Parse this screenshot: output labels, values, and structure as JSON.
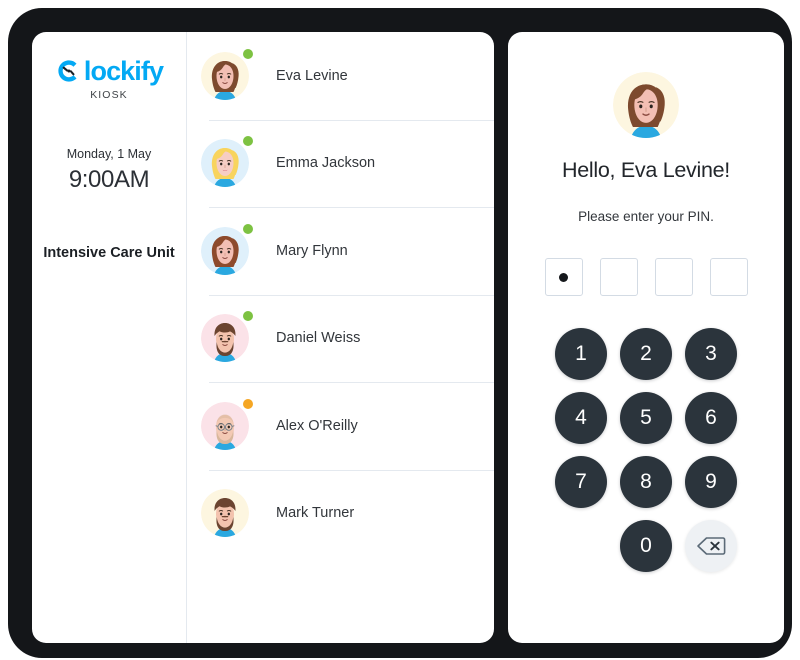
{
  "device": {
    "bezel_color": "#141619",
    "screen_bg": "#ffffff"
  },
  "colors": {
    "brand": "#03a9f4",
    "keypad": "#2b343c",
    "status_online": "#7dc242",
    "status_away": "#f5a623",
    "divider": "#e4e9ef",
    "backspace_bg": "#eef1f4"
  },
  "info_panel": {
    "logo_icon": "clockify-logo-icon",
    "logo_wordmark": "lockify",
    "kiosk_label": "KIOSK",
    "date": "Monday, 1 May",
    "time": "9:00AM",
    "department": "Intensive Care Unit"
  },
  "employee_list": {
    "items": [
      {
        "name": "Eva Levine",
        "avatar": "avatar-eva-levine",
        "status": "online",
        "status_color": "#7dc242",
        "avatar_bg": "#fdf6e0",
        "hair": "#7d4a2e",
        "skin": "#f3bfb4",
        "shirt": "#2aa8e0"
      },
      {
        "name": "Emma Jackson",
        "avatar": "avatar-emma-jackson",
        "status": "online",
        "status_color": "#7dc242",
        "avatar_bg": "#dff0fb",
        "hair": "#f8d45e",
        "skin": "#f6cdc4",
        "shirt": "#2aa8e0"
      },
      {
        "name": "Mary Flynn",
        "avatar": "avatar-mary-flynn",
        "status": "online",
        "status_color": "#7dc242",
        "avatar_bg": "#dff0fb",
        "hair": "#8d4a2c",
        "skin": "#f3bfb4",
        "shirt": "#2aa8e0"
      },
      {
        "name": "Daniel Weiss",
        "avatar": "avatar-daniel-weiss",
        "status": "online",
        "status_color": "#7dc242",
        "avatar_bg": "#fbe2e8",
        "hair": "#6b4430",
        "skin": "#f3c3ae",
        "shirt": "#2aa8e0"
      },
      {
        "name": "Alex O'Reilly",
        "avatar": "avatar-alex-oreilly",
        "status": "away",
        "status_color": "#f5a623",
        "avatar_bg": "#fbe2e8",
        "hair": "#d8b79c",
        "skin": "#f3c9b4",
        "shirt": "#2aa8e0"
      },
      {
        "name": "Mark Turner",
        "avatar": "avatar-mark-turner",
        "status": "offline",
        "status_color": "",
        "avatar_bg": "#fdf6e0",
        "hair": "#6b4430",
        "skin": "#f3c3ae",
        "shirt": "#2aa8e0"
      }
    ]
  },
  "pin_panel": {
    "avatar": "avatar-eva-levine",
    "greeting": "Hello, Eva Levine!",
    "prompt": "Please enter your PIN.",
    "pin_length": 4,
    "pin_filled_count": 1,
    "keypad": {
      "keys": [
        "1",
        "2",
        "3",
        "4",
        "5",
        "6",
        "7",
        "8",
        "9"
      ],
      "zero": "0",
      "backspace_icon": "backspace-icon"
    }
  }
}
